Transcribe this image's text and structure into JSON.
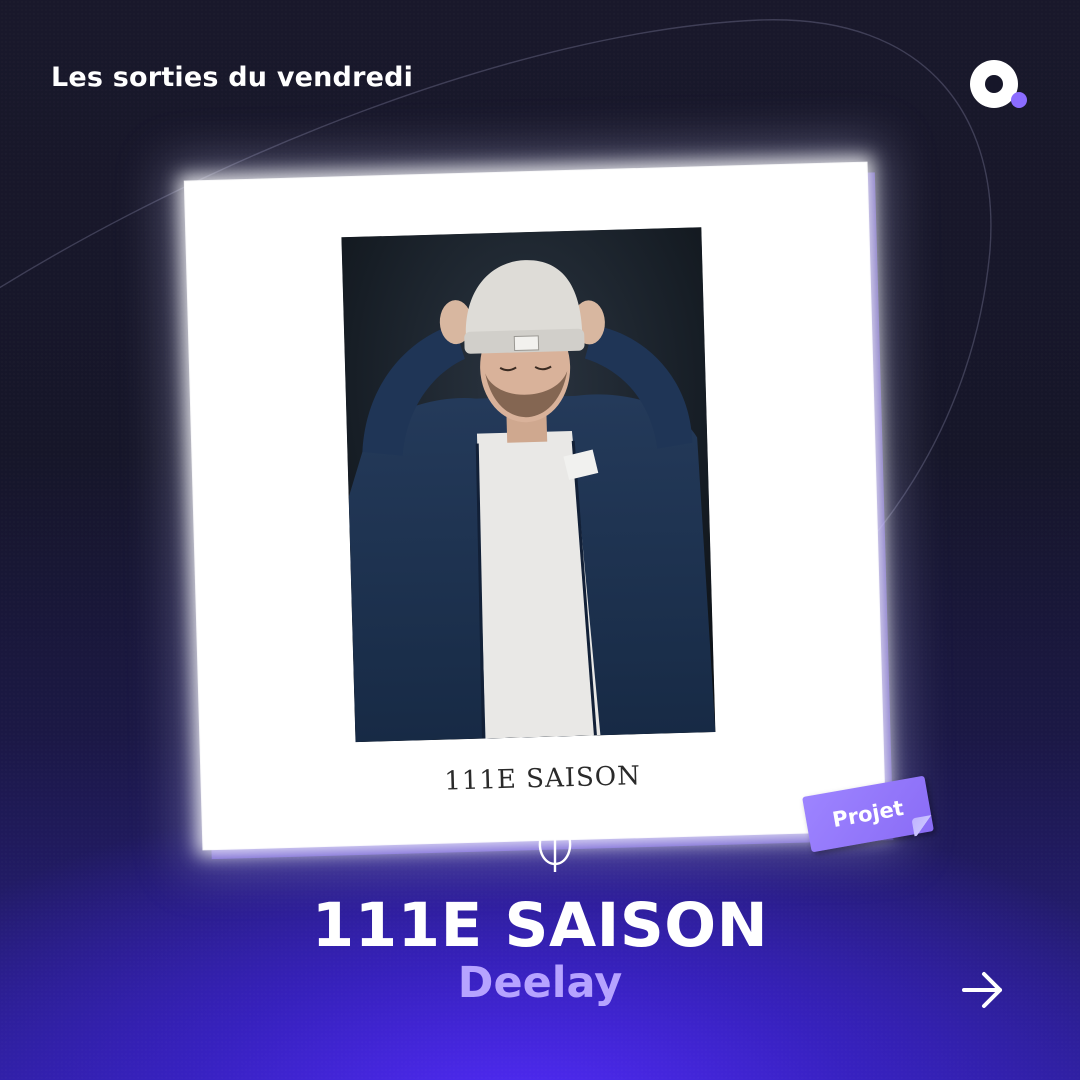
{
  "header": {
    "title": "Les sorties du vendredi"
  },
  "logo": {
    "icon": "brand-logo-icon",
    "accent_color": "#8b6cff"
  },
  "cover": {
    "caption": "111E SAISON"
  },
  "tag": {
    "label": "Projet",
    "color": "#9b84ff"
  },
  "release": {
    "title": "111E SAISON",
    "artist": "Deelay",
    "artist_color": "#b6a3ff"
  },
  "navigation": {
    "next_icon": "arrow-right-icon"
  },
  "colors": {
    "background_top": "#19182b",
    "background_bottom": "#2a1f8f",
    "accent": "#6a45ff"
  }
}
